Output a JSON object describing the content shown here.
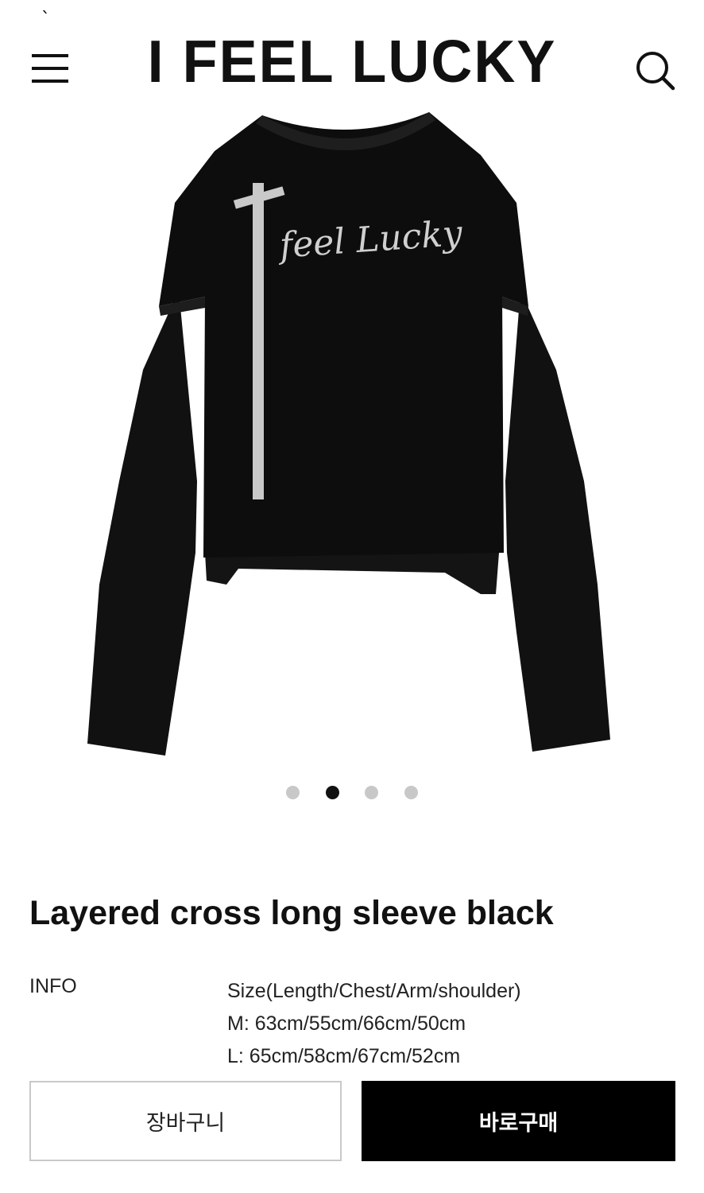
{
  "status_mark": "`",
  "header": {
    "brand": "I FEEL LUCKY",
    "menu_icon": "hamburger-menu-icon",
    "search_icon": "search-icon"
  },
  "product_image": {
    "description_icon": "product-photo",
    "print_text": "feel Lucky"
  },
  "carousel": {
    "count": 4,
    "active_index": 1
  },
  "product": {
    "name": "Layered cross long sleeve black",
    "info_label": "INFO",
    "info_lines": [
      "Size(Length/Chest/Arm/shoulder)",
      "M: 63cm/55cm/66cm/50cm",
      "L: 65cm/58cm/67cm/52cm"
    ]
  },
  "actions": {
    "cart_label": "장바구니",
    "buy_label": "바로구매"
  },
  "colors": {
    "accent": "#000000",
    "dot_inactive": "#c8c8c8",
    "border": "#c9c9c9"
  }
}
